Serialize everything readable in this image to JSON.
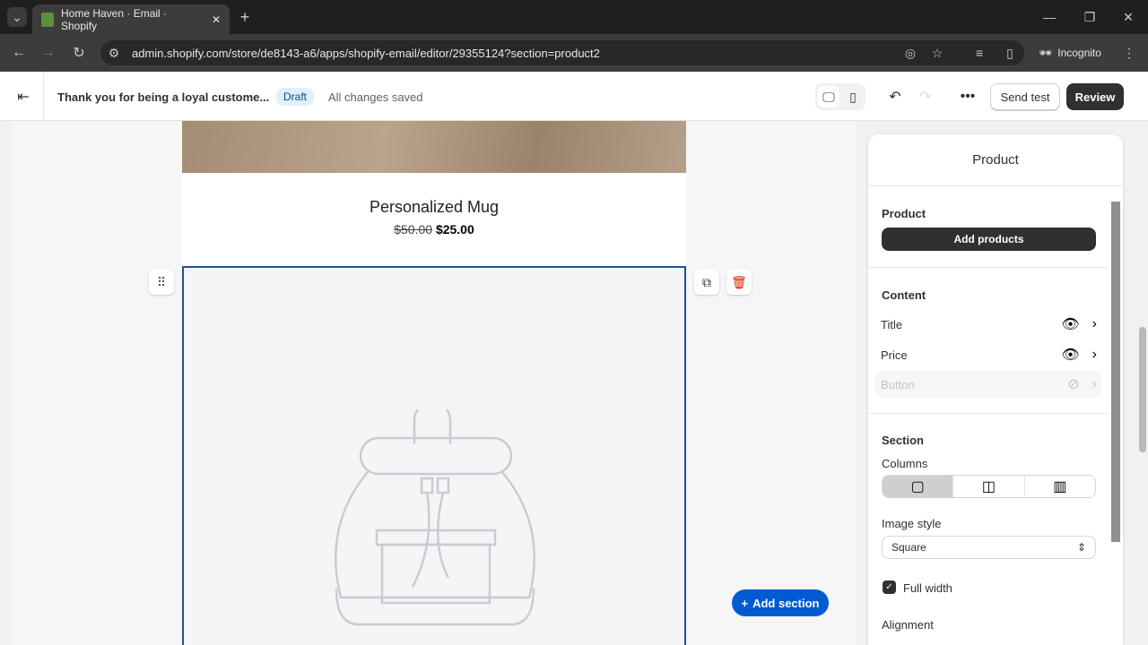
{
  "browser": {
    "tab_title": "Home Haven · Email · Shopify",
    "url": "admin.shopify.com/store/de8143-a6/apps/shopify-email/editor/29355124?section=product2",
    "profile": "Incognito"
  },
  "header": {
    "email_title": "Thank you for being a loyal custome...",
    "status": "Draft",
    "save_status": "All changes saved",
    "send_test": "Send test",
    "review": "Review"
  },
  "canvas": {
    "product_name": "Personalized Mug",
    "old_price": "$50.00",
    "price": "$25.00",
    "add_section": "Add section"
  },
  "panel": {
    "title": "Product",
    "product_heading": "Product",
    "add_products": "Add products",
    "content_heading": "Content",
    "content_items": [
      {
        "label": "Title",
        "visible": true
      },
      {
        "label": "Price",
        "visible": true
      },
      {
        "label": "Button",
        "visible": false
      }
    ],
    "section_heading": "Section",
    "columns_label": "Columns",
    "columns_selected": 1,
    "image_style_label": "Image style",
    "image_style_value": "Square",
    "full_width_label": "Full width",
    "full_width_checked": true,
    "alignment_label": "Alignment"
  },
  "colors": {
    "accent": "#1f5199",
    "primary_button": "#303030",
    "add_section": "#005bd3",
    "delete": "#e51c00"
  }
}
